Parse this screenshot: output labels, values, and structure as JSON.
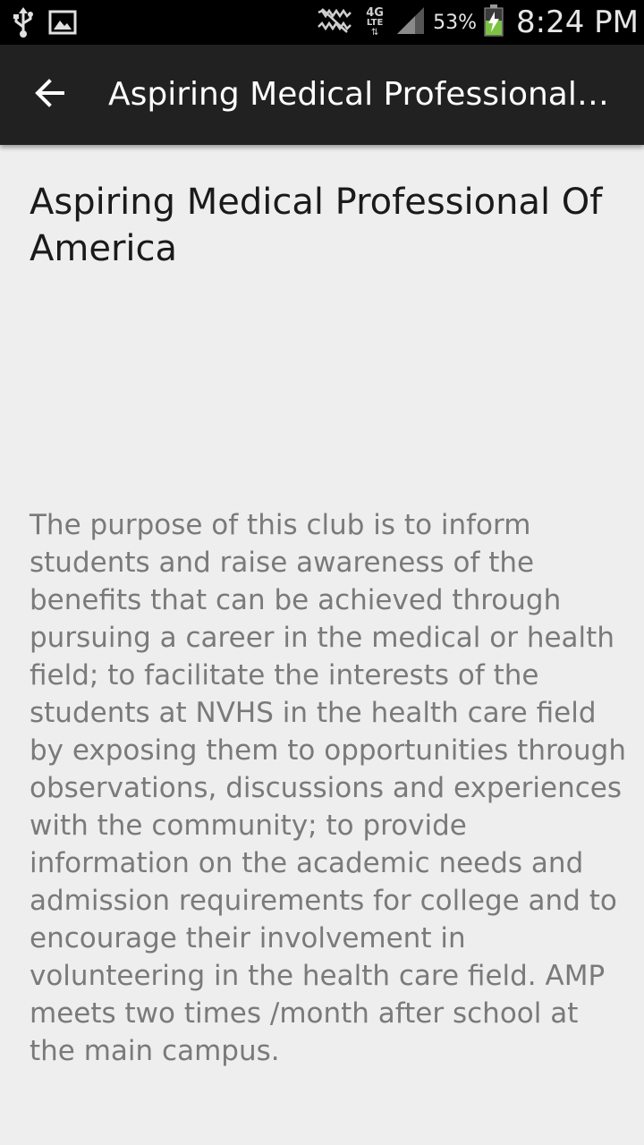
{
  "status_bar": {
    "left_icons": [
      "usb-icon",
      "image-notification-icon"
    ],
    "right_icons": [
      "no-sim-icon",
      "4g-lte-icon",
      "signal-icon",
      "battery-charging-icon"
    ],
    "battery_percent": "53%",
    "time": "8:24 PM",
    "network_label_top": "4G",
    "network_label_bottom": "LTE"
  },
  "app_bar": {
    "back_icon": "arrow-back-icon",
    "title": "Aspiring Medical Professional Of America"
  },
  "club": {
    "name": "Aspiring Medical Professional Of America",
    "description": "The purpose of this club is to inform students and raise awareness of the benefits that can be achieved through pursuing a career in the medical or health field; to facilitate the interests of the students at NVHS in the health care field by exposing them to opportunities through observations, discussions and experiences with the community; to provide information on the academic needs and admission requirements for college and to encourage their involvement in volunteering in the health care field. AMP meets two times /month after school at the main campus."
  },
  "colors": {
    "status_bar_bg": "#000000",
    "app_bar_bg": "#212121",
    "page_bg": "#eeeeee",
    "title_text": "#1a1a1a",
    "body_text": "#7a7a7a",
    "battery_green": "#7cc342"
  }
}
